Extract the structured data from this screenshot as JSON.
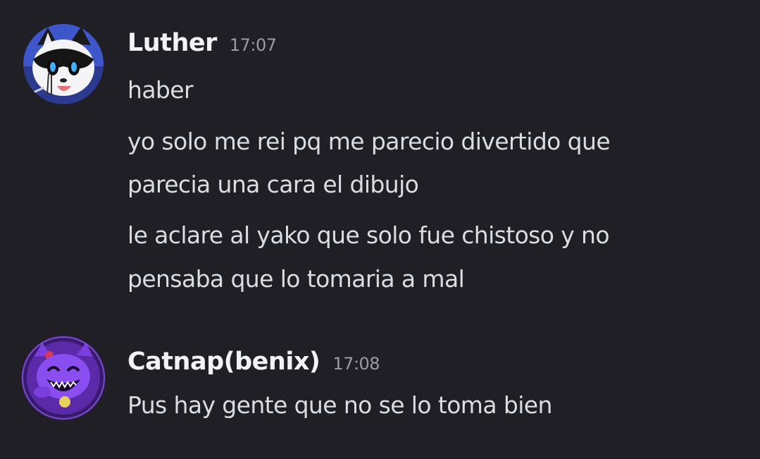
{
  "messages": [
    {
      "author": "Luther",
      "time": "17:07",
      "avatar_icon": "cat-avatar-icon",
      "lines": [
        "haber",
        "yo solo me rei pq me parecio divertido que",
        "parecia una cara el dibujo",
        "le aclare al yako que solo fue chistoso y no",
        "pensaba que lo tomaria a mal"
      ]
    },
    {
      "author": "Catnap(benix)",
      "time": "17:08",
      "avatar_icon": "purple-cat-avatar-icon",
      "lines": [
        "Pus hay gente que no se lo toma bien"
      ]
    }
  ],
  "colors": {
    "background": "#1f1f25",
    "username": "#f2f3f5",
    "timestamp": "#9a9ba3",
    "message_text": "#dbdee1"
  }
}
